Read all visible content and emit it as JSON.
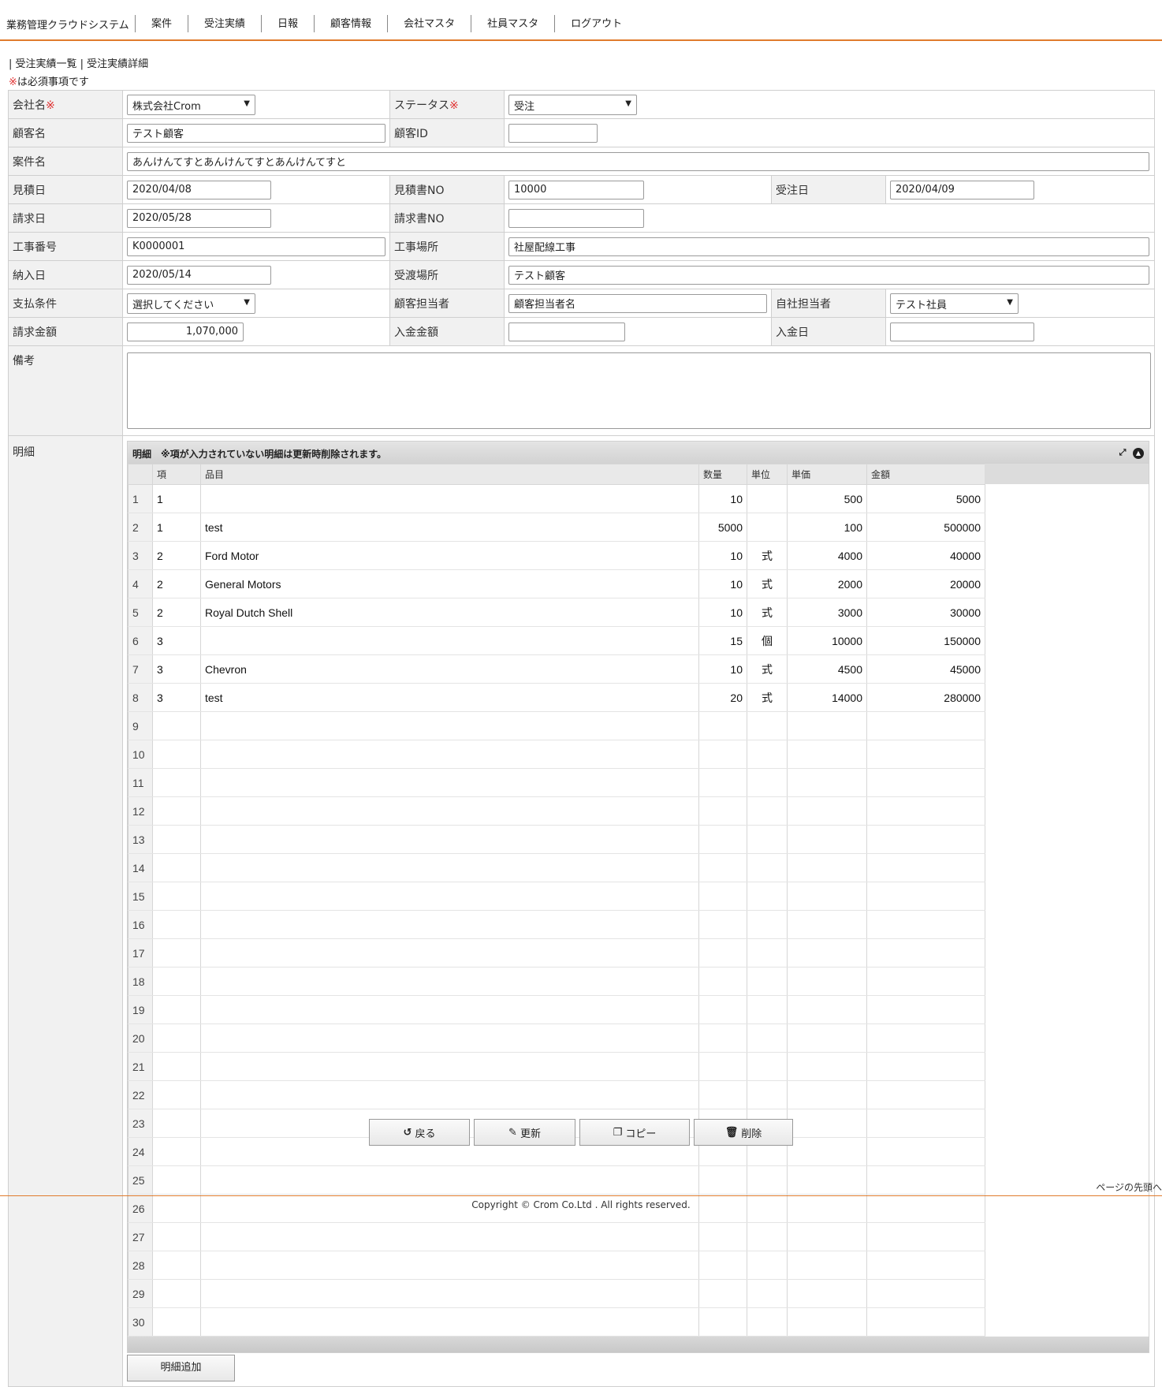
{
  "header": {
    "brand": "業務管理クラウドシステム",
    "nav": [
      "案件",
      "受注実績",
      "日報",
      "顧客情報",
      "会社マスタ",
      "社員マスタ",
      "ログアウト"
    ]
  },
  "breadcrumb": [
    "| 受注実績一覧",
    "| 受注実績詳細"
  ],
  "required_note": "※は必須事項です",
  "required_mark": "※",
  "form": {
    "company": {
      "label": "会社名",
      "value": "株式会社Crom"
    },
    "status": {
      "label": "ステータス",
      "value": "受注"
    },
    "customer_name": {
      "label": "顧客名",
      "value": "テスト顧客"
    },
    "customer_id": {
      "label": "顧客ID",
      "value": ""
    },
    "project_name": {
      "label": "案件名",
      "value": "あんけんてすとあんけんてすとあんけんてすと"
    },
    "estimate_date": {
      "label": "見積日",
      "value": "2020/04/08"
    },
    "estimate_no": {
      "label": "見積書NO",
      "value": "10000"
    },
    "order_date": {
      "label": "受注日",
      "value": "2020/04/09"
    },
    "invoice_date": {
      "label": "請求日",
      "value": "2020/05/28"
    },
    "invoice_no": {
      "label": "請求書NO",
      "value": ""
    },
    "work_no": {
      "label": "工事番号",
      "value": "K0000001"
    },
    "work_place": {
      "label": "工事場所",
      "value": "社屋配線工事"
    },
    "delivery_date": {
      "label": "納入日",
      "value": "2020/05/14"
    },
    "handover_place": {
      "label": "受渡場所",
      "value": "テスト顧客"
    },
    "payment_terms": {
      "label": "支払条件",
      "value": "選択してください"
    },
    "customer_contact": {
      "label": "顧客担当者",
      "value": "顧客担当者名"
    },
    "own_contact": {
      "label": "自社担当者",
      "value": "テスト社員"
    },
    "invoice_amount": {
      "label": "請求金額",
      "value": "1,070,000"
    },
    "payment_amount": {
      "label": "入金金額",
      "value": ""
    },
    "payment_date": {
      "label": "入金日",
      "value": ""
    },
    "remarks": {
      "label": "備考",
      "value": ""
    },
    "details_label": "明細"
  },
  "grid": {
    "title": "明細　※項が入力されていない明細は更新時削除されます。",
    "columns": [
      "項",
      "品目",
      "数量",
      "単位",
      "単価",
      "金額"
    ],
    "rows": [
      [
        "1",
        "1",
        "",
        "10",
        "",
        "500",
        "5000"
      ],
      [
        "2",
        "1",
        "test",
        "5000",
        "",
        "100",
        "500000"
      ],
      [
        "3",
        "2",
        "Ford Motor",
        "10",
        "式",
        "4000",
        "40000"
      ],
      [
        "4",
        "2",
        "General Motors",
        "10",
        "式",
        "2000",
        "20000"
      ],
      [
        "5",
        "2",
        "Royal Dutch Shell",
        "10",
        "式",
        "3000",
        "30000"
      ],
      [
        "6",
        "3",
        "",
        "15",
        "個",
        "10000",
        "150000"
      ],
      [
        "7",
        "3",
        "Chevron",
        "10",
        "式",
        "4500",
        "45000"
      ],
      [
        "8",
        "3",
        "test",
        "20",
        "式",
        "14000",
        "280000"
      ],
      [
        "9",
        "",
        "",
        "",
        "",
        "",
        ""
      ],
      [
        "10",
        "",
        "",
        "",
        "",
        "",
        ""
      ],
      [
        "11",
        "",
        "",
        "",
        "",
        "",
        ""
      ],
      [
        "12",
        "",
        "",
        "",
        "",
        "",
        ""
      ],
      [
        "13",
        "",
        "",
        "",
        "",
        "",
        ""
      ],
      [
        "14",
        "",
        "",
        "",
        "",
        "",
        ""
      ],
      [
        "15",
        "",
        "",
        "",
        "",
        "",
        ""
      ],
      [
        "16",
        "",
        "",
        "",
        "",
        "",
        ""
      ],
      [
        "17",
        "",
        "",
        "",
        "",
        "",
        ""
      ],
      [
        "18",
        "",
        "",
        "",
        "",
        "",
        ""
      ],
      [
        "19",
        "",
        "",
        "",
        "",
        "",
        ""
      ],
      [
        "20",
        "",
        "",
        "",
        "",
        "",
        ""
      ],
      [
        "21",
        "",
        "",
        "",
        "",
        "",
        ""
      ],
      [
        "22",
        "",
        "",
        "",
        "",
        "",
        ""
      ],
      [
        "23",
        "",
        "",
        "",
        "",
        "",
        ""
      ],
      [
        "24",
        "",
        "",
        "",
        "",
        "",
        ""
      ],
      [
        "25",
        "",
        "",
        "",
        "",
        "",
        ""
      ],
      [
        "26",
        "",
        "",
        "",
        "",
        "",
        ""
      ],
      [
        "27",
        "",
        "",
        "",
        "",
        "",
        ""
      ],
      [
        "28",
        "",
        "",
        "",
        "",
        "",
        ""
      ],
      [
        "29",
        "",
        "",
        "",
        "",
        "",
        ""
      ],
      [
        "30",
        "",
        "",
        "",
        "",
        "",
        ""
      ]
    ],
    "add_button": "明細追加",
    "icons": [
      "expand-icon",
      "collapse-icon"
    ]
  },
  "actions": {
    "back": {
      "label": "戻る",
      "icon": "undo-icon"
    },
    "update": {
      "label": "更新",
      "icon": "edit-icon"
    },
    "copy": {
      "label": "コピー",
      "icon": "copy-icon"
    },
    "delete": {
      "label": "削除",
      "icon": "trash-icon"
    }
  },
  "page_top": "ページの先頭へ",
  "footer": "Copyright © Crom Co.Ltd . All rights reserved.",
  "colors": {
    "accent": "#e07b2d",
    "required": "#e03030",
    "label_bg": "#f1f1f1"
  }
}
